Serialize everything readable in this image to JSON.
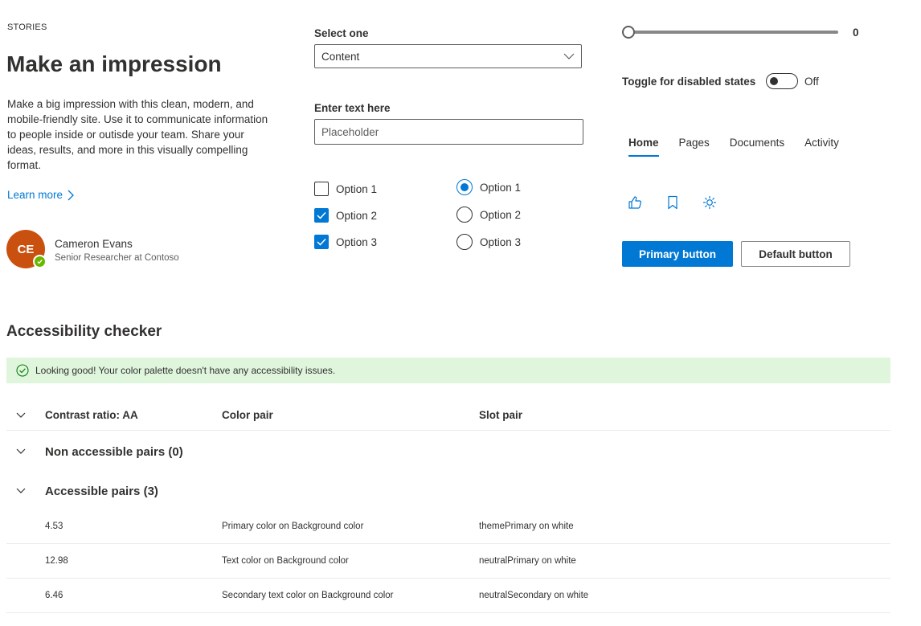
{
  "hero": {
    "eyebrow": "STORIES",
    "title": "Make an impression",
    "body": "Make a big impression with this clean, modern, and mobile-friendly site. Use it to communicate information to people inside or outisde your team. Share your ideas, results, and more in this visually compelling format.",
    "link": "Learn more"
  },
  "persona": {
    "initials": "CE",
    "name": "Cameron Evans",
    "role": "Senior Researcher at Contoso",
    "avatar_color": "#ca5010",
    "presence_color": "#6bb700"
  },
  "form": {
    "dropdown_label": "Select one",
    "dropdown_value": "Content",
    "text_label": "Enter text here",
    "text_placeholder": "Placeholder",
    "checkboxes": [
      {
        "label": "Option 1",
        "checked": false
      },
      {
        "label": "Option 2",
        "checked": true
      },
      {
        "label": "Option 3",
        "checked": true
      }
    ],
    "radios": [
      {
        "label": "Option 1",
        "selected": true
      },
      {
        "label": "Option 2",
        "selected": false
      },
      {
        "label": "Option 3",
        "selected": false
      }
    ]
  },
  "controls": {
    "slider_value": "0",
    "toggle_label": "Toggle for disabled states",
    "toggle_state": "Off",
    "tabs": [
      "Home",
      "Pages",
      "Documents",
      "Activity"
    ],
    "active_tab": "Home",
    "icons": [
      "like-icon",
      "bookmark-icon",
      "brightness-icon"
    ],
    "primary_button": "Primary button",
    "default_button": "Default button",
    "accent_color": "#0078d4"
  },
  "checker": {
    "title": "Accessibility checker",
    "banner": "Looking good! Your color palette doesn't have any accessibility issues.",
    "headers": [
      "Contrast ratio: AA",
      "Color pair",
      "Slot pair"
    ],
    "groups": [
      {
        "label": "Non accessible pairs (0)",
        "rows": []
      },
      {
        "label": "Accessible pairs (3)",
        "rows": [
          {
            "ratio": "4.53",
            "color_pair": "Primary color on Background color",
            "slot_pair": "themePrimary on white"
          },
          {
            "ratio": "12.98",
            "color_pair": "Text color on Background color",
            "slot_pair": "neutralPrimary on white"
          },
          {
            "ratio": "6.46",
            "color_pair": "Secondary text color on Background color",
            "slot_pair": "neutralSecondary on white"
          }
        ]
      }
    ]
  }
}
